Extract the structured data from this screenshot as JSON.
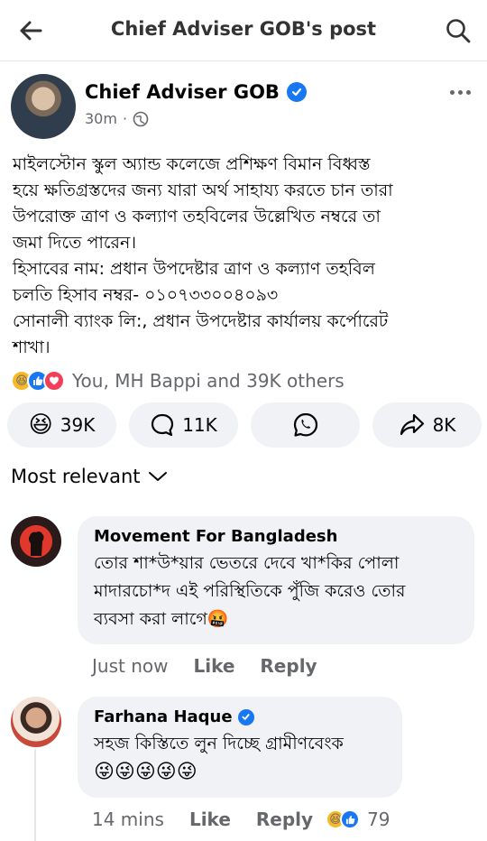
{
  "header": {
    "title": "Chief Adviser GOB's post"
  },
  "post": {
    "author": "Chief Adviser GOB",
    "time": "30m",
    "dot": "·",
    "body_lines": [
      "মাইলস্টোন স্কুল অ্যান্ড কলেজে প্রশিক্ষণ বিমান বিধ্বস্ত",
      "হয়ে ক্ষতিগ্রস্তদের জন্য যারা অর্থ সাহায্য করতে চান তারা",
      "উপরোক্ত ত্রাণ ও কল্যাণ তহবিলের উল্লেখিত নম্বরে তা",
      "জমা দিতে পারেন।",
      "হিসাবের নাম: প্রধান উপদেষ্টার ত্রাণ ও কল্যাণ তহবিল",
      "চলতি হিসাব নম্বর- ০১০৭৩৩০০৪০৯৩",
      "সোনালী ব্যাংক লি:, প্রধান উপদেষ্টার কার্যালয় কর্পোরেট",
      "শাখা।"
    ],
    "reaction_summary": "You, MH Bappi and 39K others",
    "actions": {
      "reactions_count": "39K",
      "comments_count": "11K",
      "shares_count": "8K"
    }
  },
  "sort": {
    "label": "Most relevant"
  },
  "comments": [
    {
      "name": "Movement For Bangladesh",
      "lines": [
        "তোর শা*উ*য়ার ভেতরে দেবে খা*কির পোলা",
        "মাদারচো*দ এই পরিস্থিতিকে পুঁজি করেও তোর",
        "ব্যবসা করা লাগে🤬"
      ],
      "time": "Just now",
      "like": "Like",
      "reply": "Reply"
    },
    {
      "name": "Farhana Haque",
      "lines": [
        "সহজ কিস্তিতে লুন দিচ্ছে গ্রামীণবেংক",
        "😜😜😜😜😜"
      ],
      "time": "14 mins",
      "like": "Like",
      "reply": "Reply",
      "reactions_count": "79"
    }
  ],
  "colors": {
    "accent": "#1877f2",
    "muted": "#65676b",
    "bubble": "#f0f2f5"
  }
}
